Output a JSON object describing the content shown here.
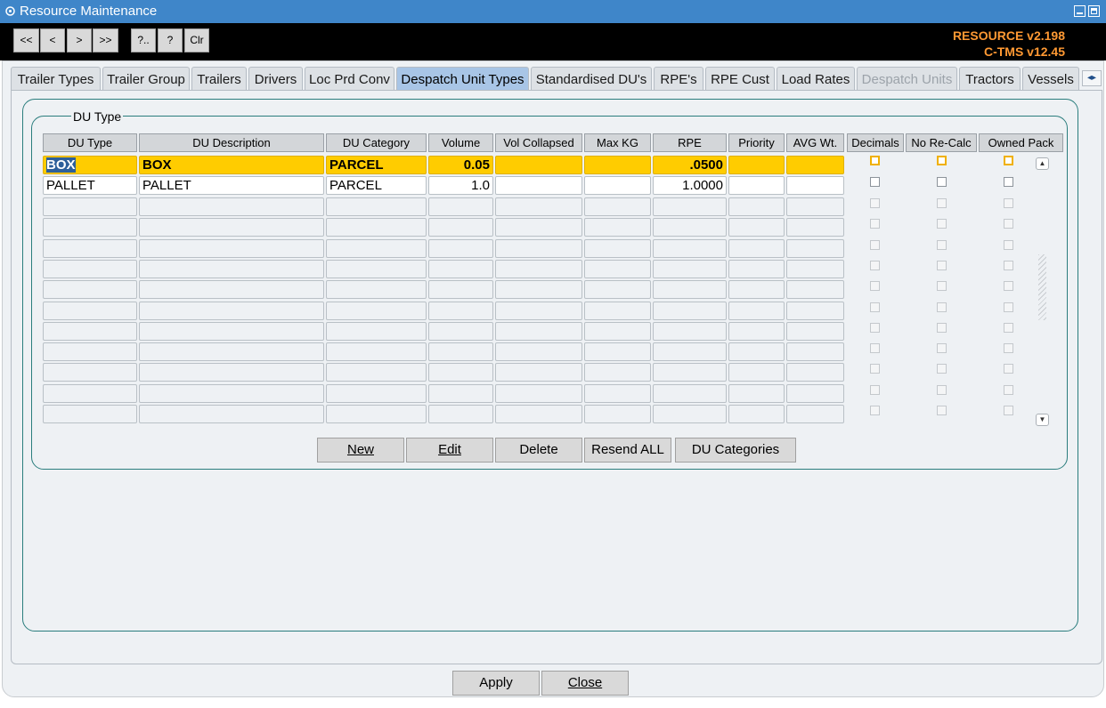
{
  "window": {
    "title": "Resource Maintenance"
  },
  "toolbar": {
    "buttons": [
      "<<",
      "<",
      ">",
      ">>",
      "?..",
      "?",
      "Clr"
    ],
    "version_resource": "RESOURCE v2.198",
    "version_ctms": "C-TMS v12.45"
  },
  "tabs": [
    "Trailer Types",
    "Trailer Group",
    "Trailers",
    "Drivers",
    "Loc Prd Conv",
    "Despatch Unit Types",
    "Standardised DU's",
    "RPE's",
    "RPE Cust",
    "Load Rates",
    "Despatch Units",
    "Tractors",
    "Vessels"
  ],
  "active_tab": "Despatch Unit Types",
  "disabled_tab": "Despatch Units",
  "group_label": "DU Type",
  "columns": [
    "DU Type",
    "DU Description",
    "DU Category",
    "Volume",
    "Vol Collapsed",
    "Max KG",
    "RPE",
    "Priority",
    "AVG Wt.",
    "Decimals",
    "No Re-Calc",
    "Owned Pack"
  ],
  "rows": [
    {
      "du_type": "BOX",
      "du_description": "BOX",
      "du_category": "PARCEL",
      "volume": "0.05",
      "vol_collapsed": "",
      "max_kg": "",
      "rpe": ".0500",
      "priority": "",
      "avg_wt": "",
      "decimals": false,
      "no_recalc": false,
      "owned_pack": false
    },
    {
      "du_type": "PALLET",
      "du_description": "PALLET",
      "du_category": "PARCEL",
      "volume": "1.0",
      "vol_collapsed": "",
      "max_kg": "",
      "rpe": "1.0000",
      "priority": "",
      "avg_wt": "",
      "decimals": false,
      "no_recalc": false,
      "owned_pack": false
    }
  ],
  "actions": {
    "new": "New",
    "edit": "Edit",
    "delete": "Delete",
    "resend_all": "Resend ALL",
    "du_categories": "DU Categories"
  },
  "footer": {
    "apply": "Apply",
    "close": "Close"
  },
  "colors": {
    "titlebar": "#3f86c9",
    "selected_row": "#ffcc00",
    "active_tab": "#a8c5e6",
    "version_text": "#ff9933",
    "group_border": "#2a7d7d"
  }
}
